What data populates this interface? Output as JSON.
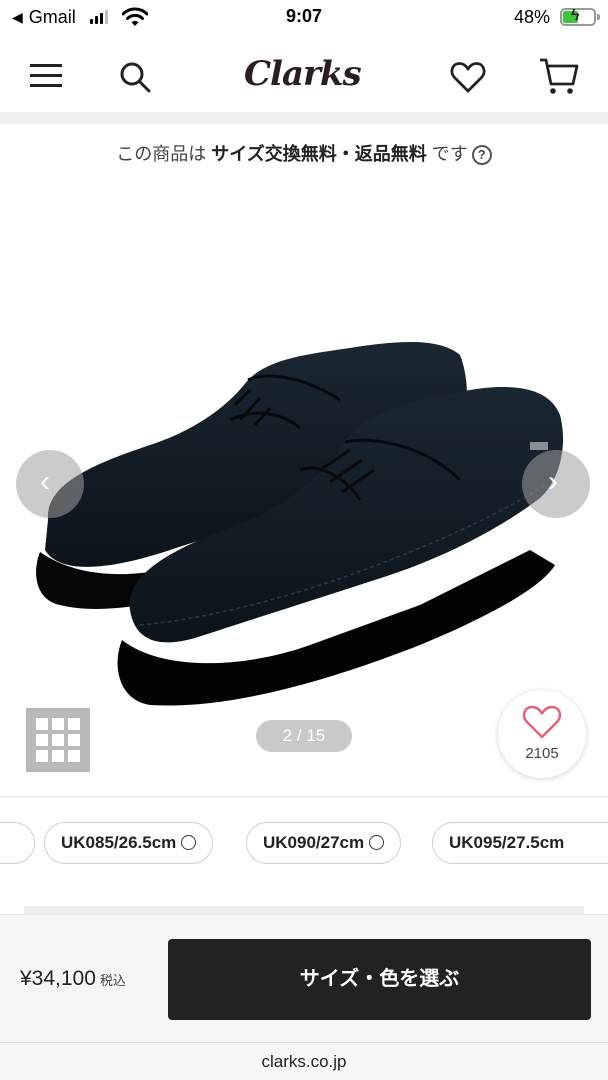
{
  "status_bar": {
    "back_app": "Gmail",
    "time": "9:07",
    "battery_percent": "48%",
    "battery_level": 0.48
  },
  "header": {
    "logo": "Clarks",
    "icons": [
      "menu-icon",
      "search-icon",
      "heart-icon",
      "cart-icon"
    ]
  },
  "notice": {
    "prefix": "この商品は ",
    "emphasis": "サイズ交換無料・返品無料",
    "suffix": " です",
    "help": "?"
  },
  "gallery": {
    "prev": "‹",
    "next": "›",
    "counter": "2 / 15",
    "current_image": 2,
    "total_images": 15
  },
  "favorite": {
    "count": "2105"
  },
  "sizes": [
    {
      "label": "",
      "available": true
    },
    {
      "label": "UK085/26.5cm",
      "available": true
    },
    {
      "label": "UK090/27cm",
      "available": true
    },
    {
      "label": "UK095/27.5cm",
      "available": true
    }
  ],
  "purchase": {
    "price": "¥34,100",
    "tax_label": "税込",
    "button_label": "サイズ・色を選ぶ"
  },
  "browser": {
    "url": "clarks.co.jp"
  },
  "colors": {
    "accent_dark": "#222222",
    "heart_pink": "#e2627a",
    "battery_green": "#3cc43c"
  }
}
